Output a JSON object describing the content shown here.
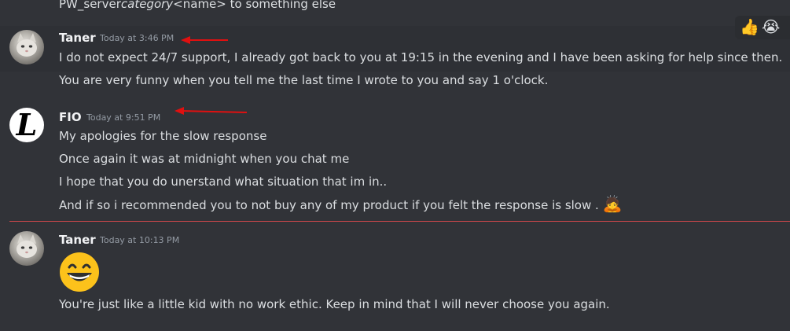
{
  "top_fragment": {
    "prefix": "PW_server",
    "italic": "category",
    "suffix": "<name> to something else"
  },
  "reactions": {
    "first": "👍",
    "second": "😭"
  },
  "messages": [
    {
      "author": "Taner",
      "timestamp": "Today at 3:46 PM",
      "lines": [
        "I do not expect 24/7 support, I already got back to you at 19:15 in the evening and I have been asking for help since then.",
        "You are very funny when you tell me the last time I wrote to you and say 1 o'clock."
      ]
    },
    {
      "author": "FIO",
      "timestamp": "Today at 9:51 PM",
      "avatar_letter": "L",
      "lines": [
        "My apologies for the slow response",
        "Once again it was at midnight when you chat me",
        "I hope that you do unerstand what situation that im in..",
        "And if so i recommended you to not buy any of my product if you felt the response is slow ."
      ],
      "trailing_emoji": "🙇"
    },
    {
      "author": "Taner",
      "timestamp": "Today at 10:13 PM",
      "emoji": "😄",
      "lines": [
        "You're just like a little kid with no work ethic. Keep in mind that I will never choose you again."
      ]
    }
  ],
  "colors": {
    "background": "#313338",
    "text": "#dbdee1",
    "username": "#f2f3f5",
    "timestamp": "#949ba4",
    "annotation_arrow": "#e01010",
    "new_divider": "#c9474a"
  }
}
